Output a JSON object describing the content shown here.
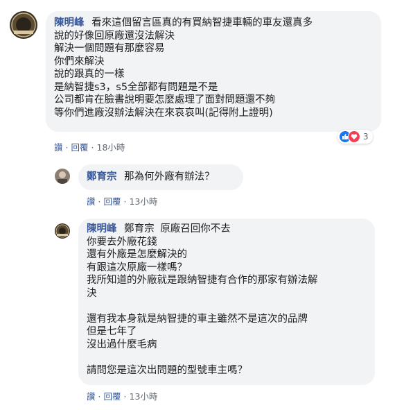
{
  "comments": [
    {
      "author": "陳明峰",
      "lines": [
        "看來這個留言區真的有買納智捷車輛的車友還真多",
        "說的好像回原廠還沒法解決",
        "解決一個問題有那麼容易",
        "你們來解決",
        "說的跟真的一樣",
        "是納智捷s3，s5全部都有問題是不是",
        "公司都肯在臉書說明要怎麼處理了面對問題還不夠",
        "等你們進廠沒辦法解決在來哀哀叫(記得附上證明)"
      ],
      "reaction_count": "3",
      "actions": {
        "like": "讚",
        "reply": "回覆",
        "time": "18小時"
      }
    },
    {
      "author": "鄭育宗",
      "lines": [
        "那為何外廠有辦法？"
      ],
      "actions": {
        "like": "讚",
        "reply": "回覆",
        "time": "13小時"
      }
    },
    {
      "author": "陳明峰",
      "mention": "鄭育宗",
      "lines": [
        "原廠召回你不去",
        "你要去外廠花錢",
        "還有外廠是怎麼解決的",
        "有跟這次原廠一樣嗎？",
        "我所知道的外廠就是跟納智捷有合作的那家有辦法解",
        "決",
        "",
        "還有我本身就是納智捷的車主雖然不是這次的品牌",
        "但是七年了",
        "沒出過什麼毛病",
        "",
        "請問您是這次出問題的型號車主嗎？"
      ],
      "actions": {
        "like": "讚",
        "reply": "回覆",
        "time": "13小時"
      }
    }
  ],
  "colors": {
    "author": "#385898",
    "bubble": "#f2f3f5",
    "meta": "#606770",
    "like": "#1877f2",
    "love": "#f33e58"
  }
}
